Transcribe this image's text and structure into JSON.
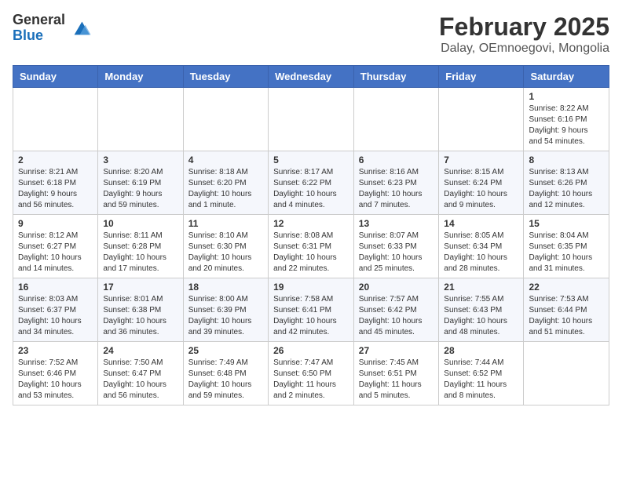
{
  "header": {
    "logo_general": "General",
    "logo_blue": "Blue",
    "title": "February 2025",
    "subtitle": "Dalay, OEmnoegovi, Mongolia"
  },
  "weekdays": [
    "Sunday",
    "Monday",
    "Tuesday",
    "Wednesday",
    "Thursday",
    "Friday",
    "Saturday"
  ],
  "weeks": [
    [
      null,
      null,
      null,
      null,
      null,
      null,
      {
        "day": "1",
        "info": "Sunrise: 8:22 AM\nSunset: 6:16 PM\nDaylight: 9 hours\nand 54 minutes."
      }
    ],
    [
      {
        "day": "2",
        "info": "Sunrise: 8:21 AM\nSunset: 6:18 PM\nDaylight: 9 hours\nand 56 minutes."
      },
      {
        "day": "3",
        "info": "Sunrise: 8:20 AM\nSunset: 6:19 PM\nDaylight: 9 hours\nand 59 minutes."
      },
      {
        "day": "4",
        "info": "Sunrise: 8:18 AM\nSunset: 6:20 PM\nDaylight: 10 hours\nand 1 minute."
      },
      {
        "day": "5",
        "info": "Sunrise: 8:17 AM\nSunset: 6:22 PM\nDaylight: 10 hours\nand 4 minutes."
      },
      {
        "day": "6",
        "info": "Sunrise: 8:16 AM\nSunset: 6:23 PM\nDaylight: 10 hours\nand 7 minutes."
      },
      {
        "day": "7",
        "info": "Sunrise: 8:15 AM\nSunset: 6:24 PM\nDaylight: 10 hours\nand 9 minutes."
      },
      {
        "day": "8",
        "info": "Sunrise: 8:13 AM\nSunset: 6:26 PM\nDaylight: 10 hours\nand 12 minutes."
      }
    ],
    [
      {
        "day": "9",
        "info": "Sunrise: 8:12 AM\nSunset: 6:27 PM\nDaylight: 10 hours\nand 14 minutes."
      },
      {
        "day": "10",
        "info": "Sunrise: 8:11 AM\nSunset: 6:28 PM\nDaylight: 10 hours\nand 17 minutes."
      },
      {
        "day": "11",
        "info": "Sunrise: 8:10 AM\nSunset: 6:30 PM\nDaylight: 10 hours\nand 20 minutes."
      },
      {
        "day": "12",
        "info": "Sunrise: 8:08 AM\nSunset: 6:31 PM\nDaylight: 10 hours\nand 22 minutes."
      },
      {
        "day": "13",
        "info": "Sunrise: 8:07 AM\nSunset: 6:33 PM\nDaylight: 10 hours\nand 25 minutes."
      },
      {
        "day": "14",
        "info": "Sunrise: 8:05 AM\nSunset: 6:34 PM\nDaylight: 10 hours\nand 28 minutes."
      },
      {
        "day": "15",
        "info": "Sunrise: 8:04 AM\nSunset: 6:35 PM\nDaylight: 10 hours\nand 31 minutes."
      }
    ],
    [
      {
        "day": "16",
        "info": "Sunrise: 8:03 AM\nSunset: 6:37 PM\nDaylight: 10 hours\nand 34 minutes."
      },
      {
        "day": "17",
        "info": "Sunrise: 8:01 AM\nSunset: 6:38 PM\nDaylight: 10 hours\nand 36 minutes."
      },
      {
        "day": "18",
        "info": "Sunrise: 8:00 AM\nSunset: 6:39 PM\nDaylight: 10 hours\nand 39 minutes."
      },
      {
        "day": "19",
        "info": "Sunrise: 7:58 AM\nSunset: 6:41 PM\nDaylight: 10 hours\nand 42 minutes."
      },
      {
        "day": "20",
        "info": "Sunrise: 7:57 AM\nSunset: 6:42 PM\nDaylight: 10 hours\nand 45 minutes."
      },
      {
        "day": "21",
        "info": "Sunrise: 7:55 AM\nSunset: 6:43 PM\nDaylight: 10 hours\nand 48 minutes."
      },
      {
        "day": "22",
        "info": "Sunrise: 7:53 AM\nSunset: 6:44 PM\nDaylight: 10 hours\nand 51 minutes."
      }
    ],
    [
      {
        "day": "23",
        "info": "Sunrise: 7:52 AM\nSunset: 6:46 PM\nDaylight: 10 hours\nand 53 minutes."
      },
      {
        "day": "24",
        "info": "Sunrise: 7:50 AM\nSunset: 6:47 PM\nDaylight: 10 hours\nand 56 minutes."
      },
      {
        "day": "25",
        "info": "Sunrise: 7:49 AM\nSunset: 6:48 PM\nDaylight: 10 hours\nand 59 minutes."
      },
      {
        "day": "26",
        "info": "Sunrise: 7:47 AM\nSunset: 6:50 PM\nDaylight: 11 hours\nand 2 minutes."
      },
      {
        "day": "27",
        "info": "Sunrise: 7:45 AM\nSunset: 6:51 PM\nDaylight: 11 hours\nand 5 minutes."
      },
      {
        "day": "28",
        "info": "Sunrise: 7:44 AM\nSunset: 6:52 PM\nDaylight: 11 hours\nand 8 minutes."
      },
      null
    ]
  ]
}
